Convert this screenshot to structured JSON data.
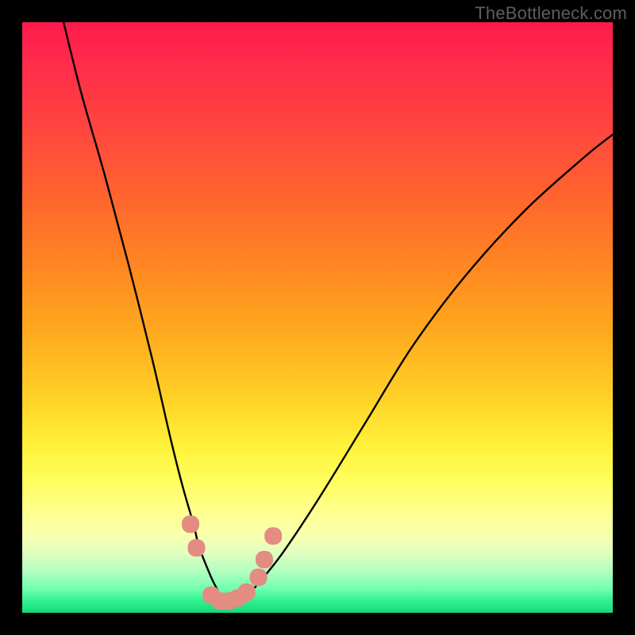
{
  "watermark": "TheBottleneck.com",
  "chart_data": {
    "type": "line",
    "title": "",
    "xlabel": "",
    "ylabel": "",
    "xlim": [
      0,
      100
    ],
    "ylim": [
      0,
      100
    ],
    "background_gradient": {
      "top_color": "#ff1a4d",
      "mid_color": "#ffff60",
      "bottom_color": "#18d878"
    },
    "series": [
      {
        "name": "bottleneck-curve",
        "color": "#000000",
        "x": [
          7,
          10,
          14,
          18,
          22,
          25,
          27,
          29,
          30,
          32,
          33,
          34,
          35,
          36,
          38,
          40,
          44,
          50,
          58,
          66,
          75,
          85,
          95,
          100
        ],
        "y": [
          100,
          88,
          74,
          59,
          43,
          30,
          22,
          15,
          11,
          6,
          4,
          2,
          2,
          2,
          3,
          5,
          10,
          19,
          32,
          45,
          57,
          68,
          77,
          81
        ]
      }
    ],
    "markers": {
      "name": "highlight-beads",
      "shape": "rounded-square",
      "color": "#e48b82",
      "points": [
        {
          "x": 28.5,
          "y": 15
        },
        {
          "x": 29.5,
          "y": 11
        },
        {
          "x": 32.0,
          "y": 3
        },
        {
          "x": 33.5,
          "y": 2
        },
        {
          "x": 35.0,
          "y": 2
        },
        {
          "x": 36.5,
          "y": 2.5
        },
        {
          "x": 38.0,
          "y": 3.5
        },
        {
          "x": 40.0,
          "y": 6
        },
        {
          "x": 41.0,
          "y": 9
        },
        {
          "x": 42.5,
          "y": 13
        }
      ]
    }
  }
}
